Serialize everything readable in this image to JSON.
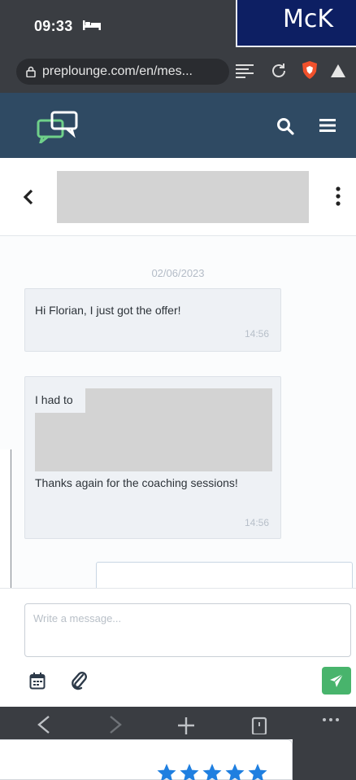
{
  "status_bar": {
    "time": "09:33"
  },
  "brand_banner": {
    "text": "McK"
  },
  "browser": {
    "url": "preplounge.com/en/mes...",
    "icons": [
      "lock-icon",
      "reader-mode-icon",
      "reload-icon",
      "brave-shield-icon",
      "triangle-icon"
    ]
  },
  "site_header": {
    "logo": "preplounge-chat-logo",
    "icons": [
      "search-icon",
      "menu-icon"
    ]
  },
  "conversation": {
    "contact_name_redacted": true,
    "date": "02/06/2023",
    "messages": [
      {
        "text": "Hi Florian, I just got the offer!",
        "time": "14:56"
      },
      {
        "text_start": "I had to",
        "text_end": "Thanks again for the coaching sessions!",
        "middle_redacted": true,
        "time": "14:56"
      }
    ]
  },
  "composer": {
    "placeholder": "Write a message...",
    "value": "",
    "icons": [
      "calendar-icon",
      "paperclip-icon",
      "send-icon"
    ]
  },
  "review": {
    "rating": 5,
    "max_rating": 5
  },
  "colors": {
    "site_header": "#2f4a63",
    "bubble": "#eef1f5",
    "send_button": "#48b46c",
    "stars": "#1f7fe0",
    "brand_banner": "#0d1f63"
  }
}
